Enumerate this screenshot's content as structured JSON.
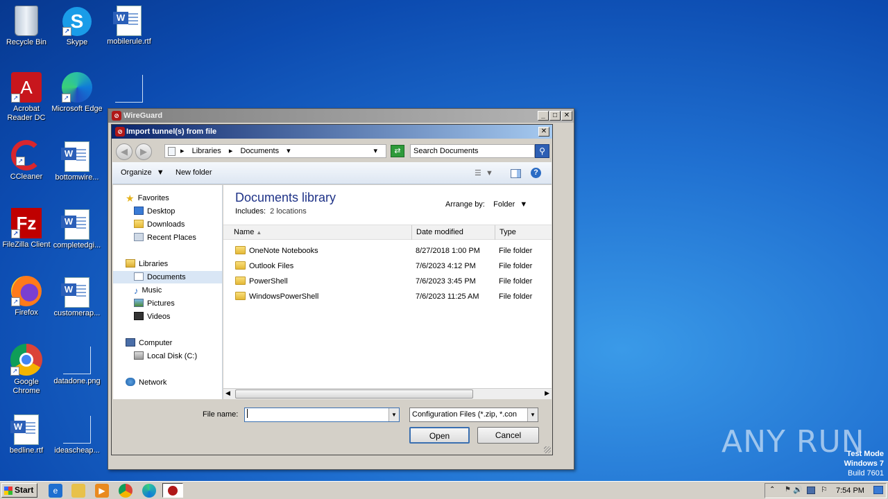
{
  "desktop": {
    "icons": [
      {
        "label": "Recycle Bin"
      },
      {
        "label": "Skype"
      },
      {
        "label": "mobilerule.rtf"
      },
      {
        "label": "Acrobat Reader DC"
      },
      {
        "label": "Microsoft Edge"
      },
      {
        "label": "CCleaner"
      },
      {
        "label": "bottomwire..."
      },
      {
        "label": "FileZilla Client"
      },
      {
        "label": "completedgi..."
      },
      {
        "label": "Firefox"
      },
      {
        "label": "customerap..."
      },
      {
        "label": "Google Chrome"
      },
      {
        "label": "datadone.png"
      },
      {
        "label": "bedline.rtf"
      },
      {
        "label": "ideascheap..."
      }
    ],
    "watermark": {
      "brand": "ANY RUN",
      "mode": "Test Mode",
      "os": "Windows 7",
      "build": "Build 7601"
    }
  },
  "wireguard": {
    "title": "WireGuard",
    "minimize": "_",
    "maximize": "□",
    "close": "✕"
  },
  "dialog": {
    "title": "Import tunnel(s) from file",
    "close": "✕",
    "breadcrumb": [
      "Libraries",
      "Documents"
    ],
    "search_placeholder": "Search Documents",
    "toolbar": {
      "organize": "Organize",
      "new_folder": "New folder",
      "help": "?"
    },
    "nav": {
      "favorites": "Favorites",
      "desktop": "Desktop",
      "downloads": "Downloads",
      "recent": "Recent Places",
      "libraries": "Libraries",
      "documents": "Documents",
      "music": "Music",
      "pictures": "Pictures",
      "videos": "Videos",
      "computer": "Computer",
      "local_disk": "Local Disk (C:)",
      "network": "Network"
    },
    "library": {
      "title": "Documents library",
      "includes_label": "Includes:",
      "includes_value": "2 locations",
      "arrange_label": "Arrange by:",
      "arrange_value": "Folder"
    },
    "columns": {
      "name": "Name",
      "date": "Date modified",
      "type": "Type"
    },
    "files": [
      {
        "name": "OneNote Notebooks",
        "date": "8/27/2018 1:00 PM",
        "type": "File folder"
      },
      {
        "name": "Outlook Files",
        "date": "7/6/2023 4:12 PM",
        "type": "File folder"
      },
      {
        "name": "PowerShell",
        "date": "7/6/2023 3:45 PM",
        "type": "File folder"
      },
      {
        "name": "WindowsPowerShell",
        "date": "7/6/2023 11:25 AM",
        "type": "File folder"
      }
    ],
    "filename_label": "File name:",
    "filename_value": "",
    "filter_value": "Configuration Files (*.zip, *.con",
    "open_label": "Open",
    "cancel_label": "Cancel"
  },
  "taskbar": {
    "start_label": "Start",
    "clock": "7:54 PM"
  }
}
